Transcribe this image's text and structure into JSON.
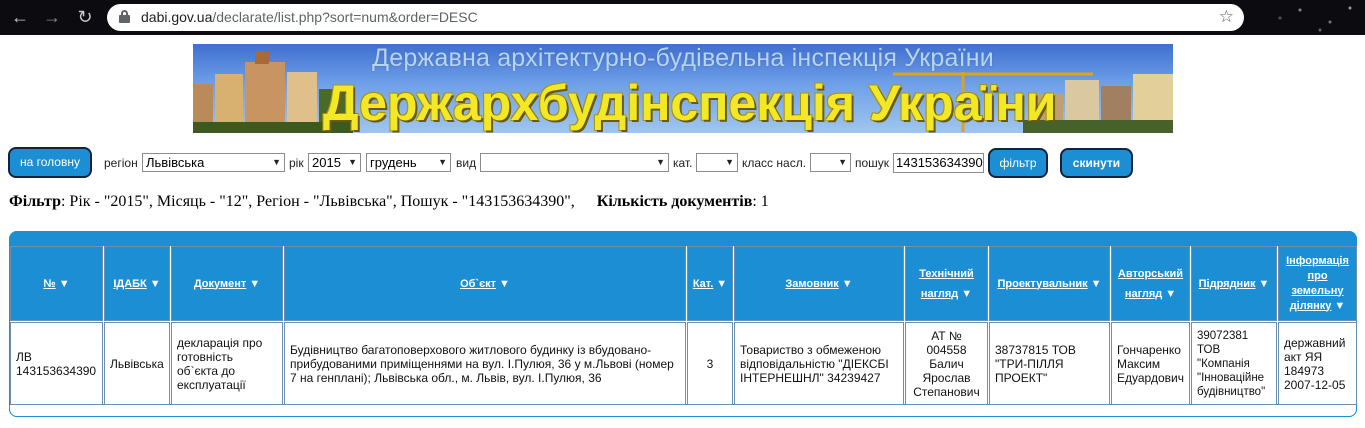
{
  "browser": {
    "url_domain": "dabi.gov.ua",
    "url_path": "/declarate/list.php?sort=num&order=DESC"
  },
  "banner": {
    "subtitle": "Державна архітектурно-будівельна інспекція України",
    "title": "Держархбудінспекція України"
  },
  "filters": {
    "home_button": "на головну",
    "region_label": "регіон",
    "region_value": "Львівська",
    "year_label": "рік",
    "year_value": "2015",
    "month_value": "грудень",
    "type_label": "вид",
    "type_value": "",
    "cat_label": "кат.",
    "cat_value": "",
    "class_label": "класс насл.",
    "class_value": "",
    "search_label": "пошук",
    "search_value": "143153634390",
    "filter_button": "фільтр",
    "reset_button": "скинути"
  },
  "summary": {
    "filter_label": "Фільтр",
    "filter_text": ": Рік - \"2015\", Місяць - \"12\", Регіон - \"Львівська\", Пошук - \"143153634390\",",
    "count_label": "Кількість документів",
    "count_text": ": 1"
  },
  "table": {
    "headers": [
      [
        "№"
      ],
      [
        "ІДАБК"
      ],
      [
        "Документ"
      ],
      [
        "Об`єкт"
      ],
      [
        "Кат."
      ],
      [
        "Замовник"
      ],
      [
        "Технічний",
        "нагляд"
      ],
      [
        "Проектувальник"
      ],
      [
        "Авторський",
        "нагляд"
      ],
      [
        "Підрядник"
      ],
      [
        "Інформація",
        "про",
        "земельну",
        "ділянку"
      ]
    ],
    "rows": [
      [
        "ЛВ 143153634390",
        "Львівська",
        "декларація про готовність об`єкта до експлуатації",
        "Будівництво багатоповерхового житлового будинку із вбудовано-прибудованими приміщеннями на вул. І.Пулюя, 36 у м.Львові (номер 7 на генплані); Львівська обл., м. Львів, вул. І.Пулюя, 36",
        "3",
        "Товариство з обмеженою відповідальністю \"ДІЕКСБІ ІНТЕРНЕШНЛ\" 34239427",
        "АТ № 004558 Балич Ярослав Степанович",
        "38737815 ТОВ \"ТРИ-ПІЛЛЯ ПРОЕКТ\"",
        "Гончаренко Максим Едуардович",
        "39072381 ТОВ \"Компанія \"Інноваційне будівництво\"",
        "державний акт ЯЯ 184973 2007-12-05"
      ]
    ]
  }
}
